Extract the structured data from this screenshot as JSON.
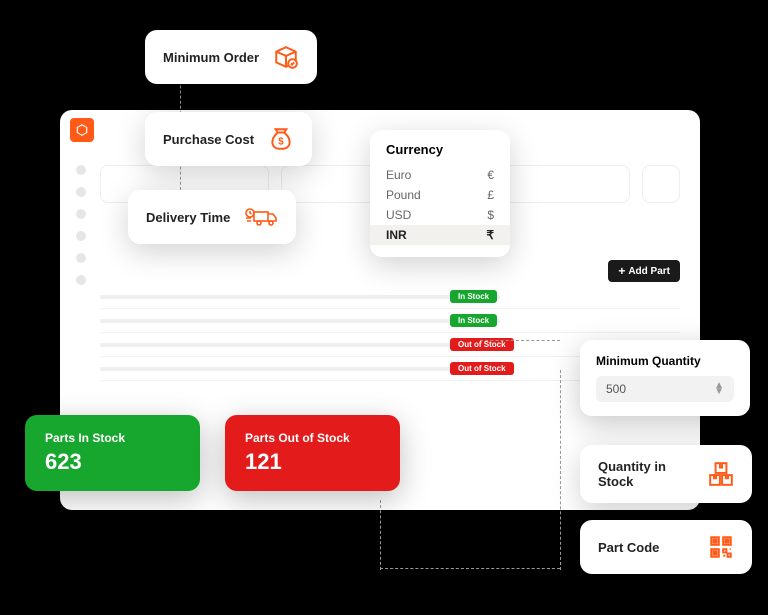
{
  "cards": {
    "minimum_order": "Minimum Order",
    "purchase_cost": "Purchase Cost",
    "delivery_time": "Delivery Time",
    "quantity_in_stock": "Quantity in Stock",
    "part_code": "Part Code"
  },
  "currency": {
    "title": "Currency",
    "options": [
      {
        "name": "Euro",
        "symbol": "€"
      },
      {
        "name": "Pound",
        "symbol": "£"
      },
      {
        "name": "USD",
        "symbol": "$"
      },
      {
        "name": "INR",
        "symbol": "₹"
      }
    ]
  },
  "add_part": "Add Part",
  "status": {
    "in_stock": "In Stock",
    "out_of_stock": "Out of Stock"
  },
  "stats": {
    "in_stock": {
      "label": "Parts In Stock",
      "value": "623"
    },
    "out_of_stock": {
      "label": "Parts Out of Stock",
      "value": "121"
    }
  },
  "min_quantity": {
    "label": "Minimum Quantity",
    "value": "500"
  }
}
